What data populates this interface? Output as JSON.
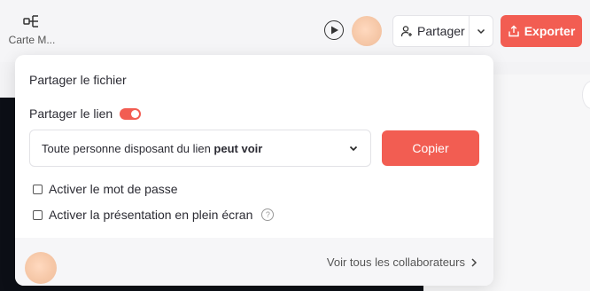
{
  "toolbar": {
    "mindmap_label": "Carte M...",
    "play_icon": "play-circle-icon",
    "share_label": "Partager",
    "export_label": "Exporter"
  },
  "share_popover": {
    "title": "Partager le fichier",
    "link_label": "Partager le lien",
    "link_enabled": true,
    "permission_text": "Toute personne disposant du lien ",
    "permission_value": "peut voir",
    "copy_label": "Copier",
    "password_option": "Activer le mot de passe",
    "password_checked": false,
    "fullscreen_option": "Activer la présentation en plein écran",
    "fullscreen_checked": false,
    "help_glyph": "?",
    "see_all_label": "Voir tous les collaborateurs"
  },
  "colors": {
    "accent": "#f25d52",
    "canvas_dark": "#0c0f16"
  }
}
